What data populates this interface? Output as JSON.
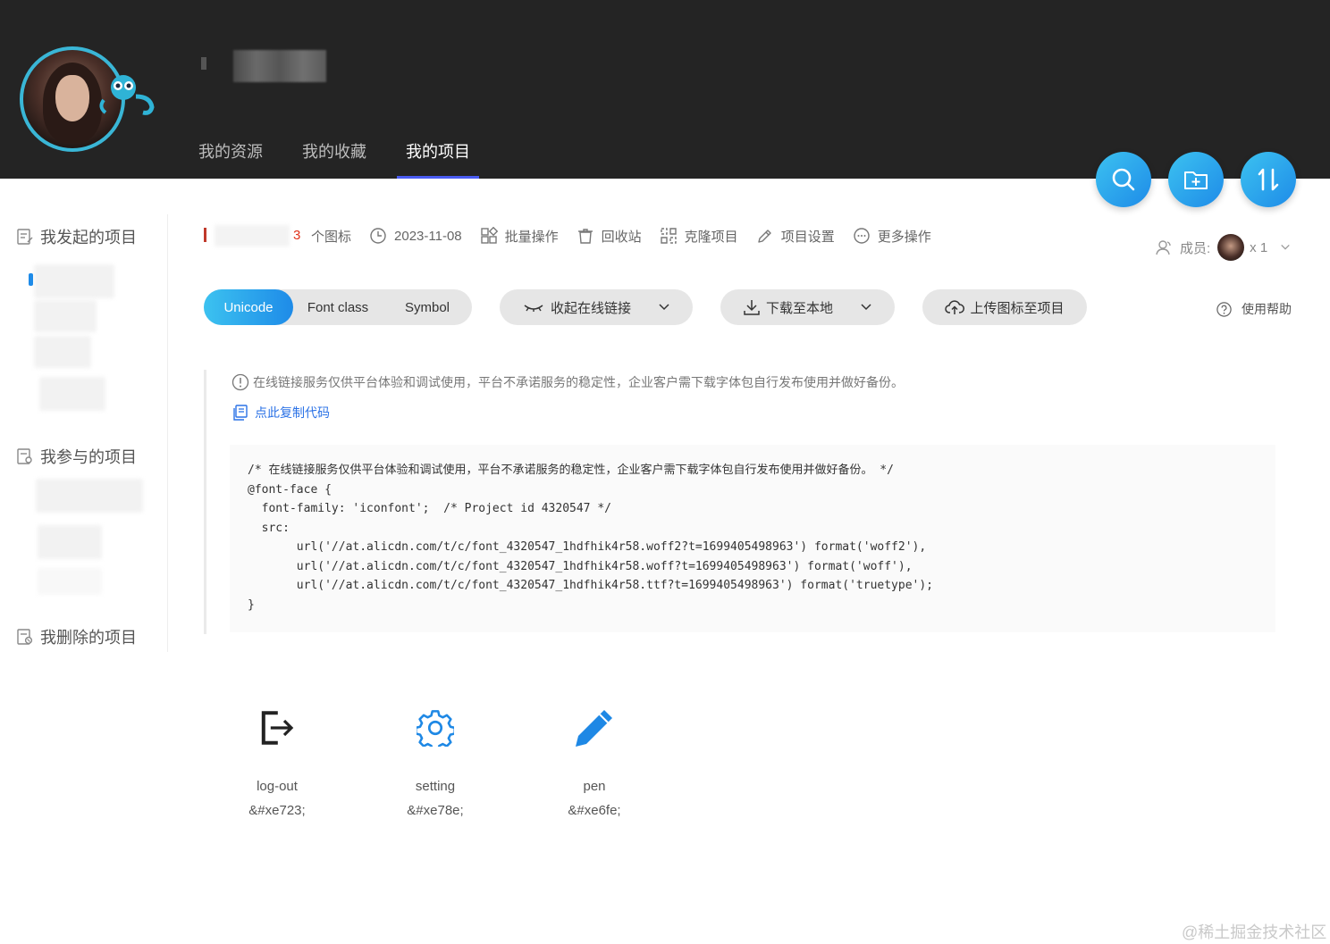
{
  "nav": [
    {
      "label": "我的资源"
    },
    {
      "label": "我的收藏"
    },
    {
      "label": "我的项目",
      "active": true
    }
  ],
  "fab": [
    "search-icon",
    "folder-add-icon",
    "sort-icon"
  ],
  "sidebar": {
    "initiated": "我发起的项目",
    "joined": "我参与的项目",
    "deleted": "我删除的项目"
  },
  "project": {
    "icon_count": "3",
    "icon_count_label": "个图标",
    "date": "2023-11-08",
    "batch": "批量操作",
    "recycle": "回收站",
    "clone": "克隆项目",
    "settings": "项目设置",
    "more": "更多操作"
  },
  "members": {
    "label": "成员:",
    "count": "x 1"
  },
  "tabs": {
    "unicode": "Unicode",
    "font_class": "Font class",
    "symbol": "Symbol"
  },
  "actions": {
    "collapse_link": "收起在线链接",
    "download": "下载至本地",
    "upload": "上传图标至项目",
    "help": "使用帮助"
  },
  "notice": {
    "text": "在线链接服务仅供平台体验和调试使用，平台不承诺服务的稳定性，企业客户需下载字体包自行发布使用并做好备份。",
    "copy": "点此复制代码"
  },
  "code": "/* 在线链接服务仅供平台体验和调试使用，平台不承诺服务的稳定性，企业客户需下载字体包自行发布使用并做好备份。 */\n@font-face {\n  font-family: 'iconfont';  /* Project id 4320547 */\n  src:\n       url('//at.alicdn.com/t/c/font_4320547_1hdfhik4r58.woff2?t=1699405498963') format('woff2'),\n       url('//at.alicdn.com/t/c/font_4320547_1hdfhik4r58.woff?t=1699405498963') format('woff'),\n       url('//at.alicdn.com/t/c/font_4320547_1hdfhik4r58.ttf?t=1699405498963') format('truetype');\n}",
  "icons": [
    {
      "name": "log-out",
      "code": "&#xe723;",
      "color": "#222222"
    },
    {
      "name": "setting",
      "code": "&#xe78e;",
      "color": "#1e88e5"
    },
    {
      "name": "pen",
      "code": "&#xe6fe;",
      "color": "#1e88e5"
    }
  ],
  "watermark": "@稀土掘金技术社区",
  "colors": {
    "header_bg": "#242424",
    "accent": "#1e8be8",
    "nav_underline": "#4a5cf2"
  }
}
